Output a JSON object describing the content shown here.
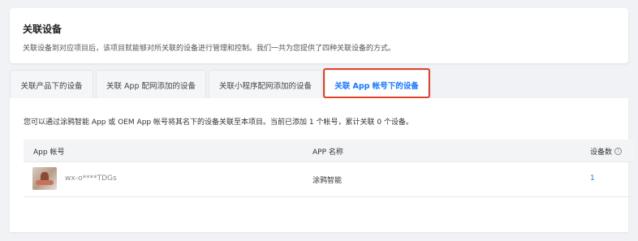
{
  "header": {
    "title": "关联设备",
    "description": "关联设备到对应项目后，该项目就能够对所关联的设备进行管理和控制。我们一共为您提供了四种关联设备的方式。"
  },
  "tabs": [
    {
      "label": "关联产品下的设备"
    },
    {
      "label": "关联 App 配网添加的设备"
    },
    {
      "label": "关联小程序配网添加的设备"
    },
    {
      "label": "关联 App 帐号下的设备"
    }
  ],
  "active_tab_index": 3,
  "main": {
    "info_text": "您可以通过涂鸦智能 App 或 OEM App 帐号将其名下的设备关联至本项目。当前已添加 1 个帐号，累计关联 0 个设备。"
  },
  "table": {
    "columns": {
      "account": "App 帐号",
      "app_name": "APP 名称",
      "device_count": "设备数"
    },
    "rows": [
      {
        "account": "wx-o****TDGs",
        "app_name": "涂鸦智能",
        "device_count": "1"
      }
    ]
  },
  "colors": {
    "accent": "#1677ff",
    "highlight_border": "#e0442b"
  },
  "icons": {
    "device_count_info": "info-circle-icon"
  }
}
